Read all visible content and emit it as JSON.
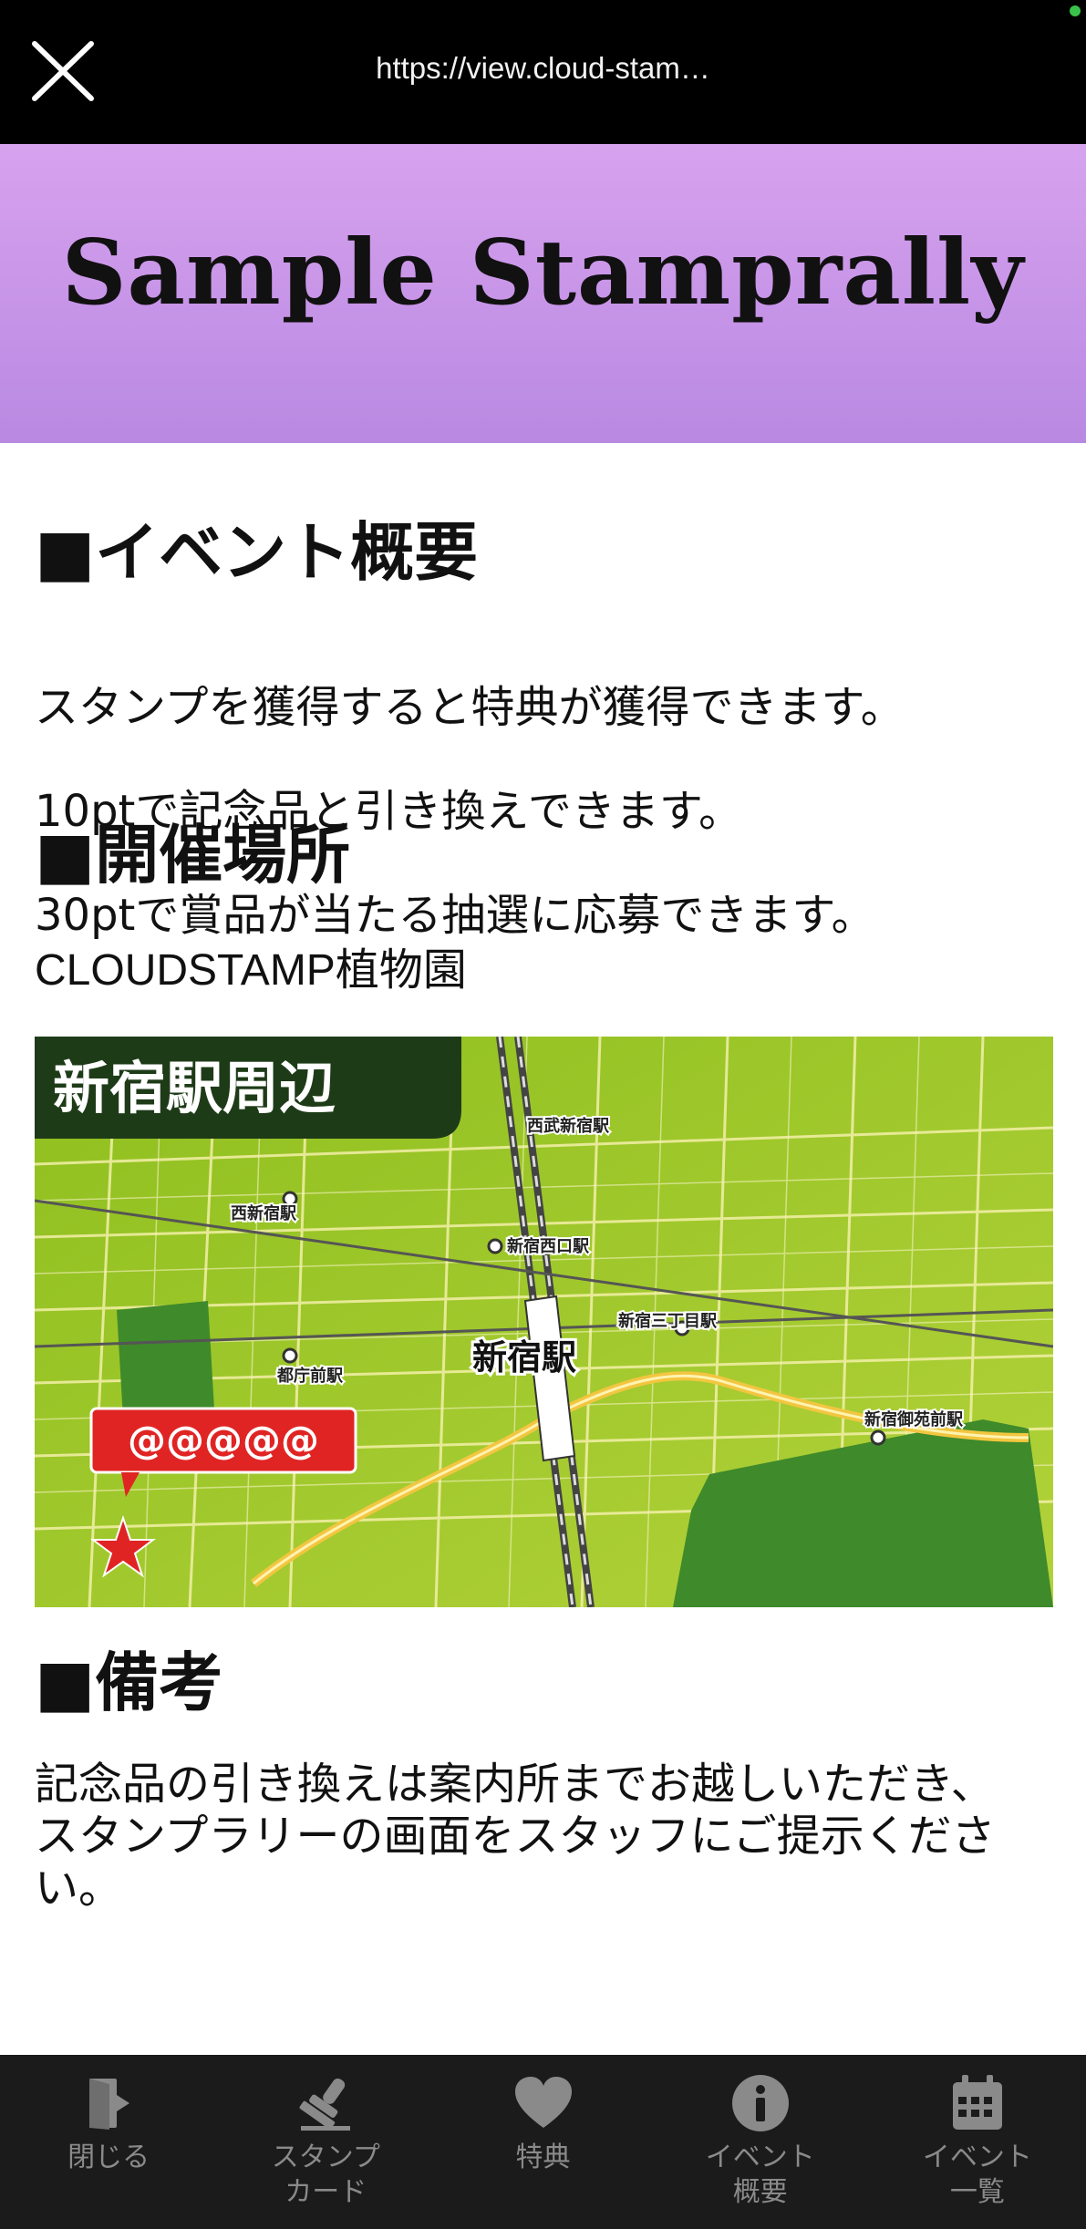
{
  "browser": {
    "url": "https://view.cloud-stam…",
    "close_icon": "close-icon"
  },
  "banner": {
    "title": "Sample Stamprally",
    "background": "#c89aea"
  },
  "sections": {
    "overview": {
      "heading": "■イベント概要",
      "lines": [
        "スタンプを獲得すると特典が獲得できます。",
        "10ptで記念品と引き換えできます。",
        "30ptで賞品が当たる抽選に応募できます。"
      ]
    },
    "venue": {
      "heading": "■開催場所",
      "text": "CLOUDSTAMP植物園"
    },
    "map": {
      "title": "新宿駅周辺",
      "station_main": "新宿駅",
      "stations": [
        "西武新宿駅",
        "西新宿駅",
        "新宿西口駅",
        "新宿三丁目駅",
        "都庁前駅",
        "新宿御苑前駅"
      ],
      "marker_label": "@@@@@",
      "marker_icon": "star-icon"
    },
    "notes": {
      "heading": "■備考",
      "lines": [
        "記念品の引き換えは案内所までお越しいただき、",
        "スタンプラリーの画面をスタッフにご提示ください。"
      ]
    }
  },
  "nav": [
    {
      "label": "閉じる",
      "icon": "exit-door-icon"
    },
    {
      "label": "スタンプ\nカード",
      "icon": "stamp-icon"
    },
    {
      "label": "特典",
      "icon": "heart-icon"
    },
    {
      "label": "イベント\n概要",
      "icon": "info-icon"
    },
    {
      "label": "イベント\n一覧",
      "icon": "calendar-icon"
    }
  ]
}
